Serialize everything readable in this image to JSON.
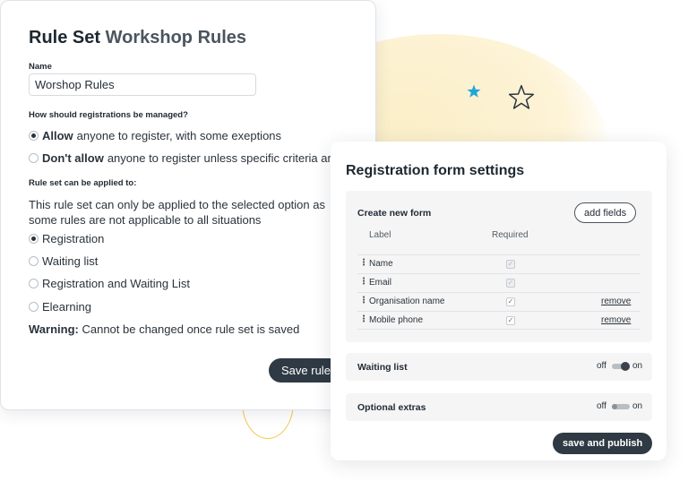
{
  "rule_set": {
    "title_prefix": "Rule Set",
    "title_name": "Workshop Rules",
    "name_label": "Name",
    "name_value": "Worshop Rules",
    "registration_question": "How should registrations be managed?",
    "registration_options": [
      {
        "bold": "Allow",
        "rest": "anyone to register, with some exeptions",
        "selected": true
      },
      {
        "bold": "Don't allow",
        "rest": "anyone to register unless specific criteria are",
        "selected": false
      }
    ],
    "applied_label": "Rule set can be applied to:",
    "applied_note": "This rule set can only be applied to the selected option as some rules are not applicable to all situations",
    "applied_options": [
      {
        "label": "Registration",
        "selected": true
      },
      {
        "label": "Waiting list",
        "selected": false
      },
      {
        "label": "Registration and Waiting List",
        "selected": false
      },
      {
        "label": "Elearning",
        "selected": false
      }
    ],
    "warning_bold": "Warning:",
    "warning_text": "Cannot be changed once rule set is saved",
    "save_label": "Save rule"
  },
  "form_settings": {
    "title": "Registration form settings",
    "create_heading": "Create new form",
    "add_fields_label": "add fields",
    "col_label": "Label",
    "col_required": "Required",
    "fields": [
      {
        "name": "Name",
        "required": true,
        "locked": true,
        "removable": false
      },
      {
        "name": "Email",
        "required": true,
        "locked": true,
        "removable": false
      },
      {
        "name": "Organisation name",
        "required": true,
        "locked": false,
        "removable": true,
        "remove_label": "remove"
      },
      {
        "name": "Mobile phone",
        "required": true,
        "locked": false,
        "removable": true,
        "remove_label": "remove"
      }
    ],
    "waiting_list": {
      "label": "Waiting list",
      "off": "off",
      "on": "on",
      "value": "on"
    },
    "optional_extras": {
      "label": "Optional extras",
      "off": "off",
      "on": "on",
      "value": "off"
    },
    "publish_label": "save and publish"
  },
  "colors": {
    "accent_dark": "#2f3a44",
    "star_blue": "#1fa7d8",
    "blob_yellow": "#fbefc8",
    "ring_yellow": "#f2c94c"
  },
  "icons": [
    "star-icon",
    "star-outline-icon",
    "drag-handle-icon",
    "checkbox-icon",
    "toggle-icon",
    "radio-icon"
  ]
}
